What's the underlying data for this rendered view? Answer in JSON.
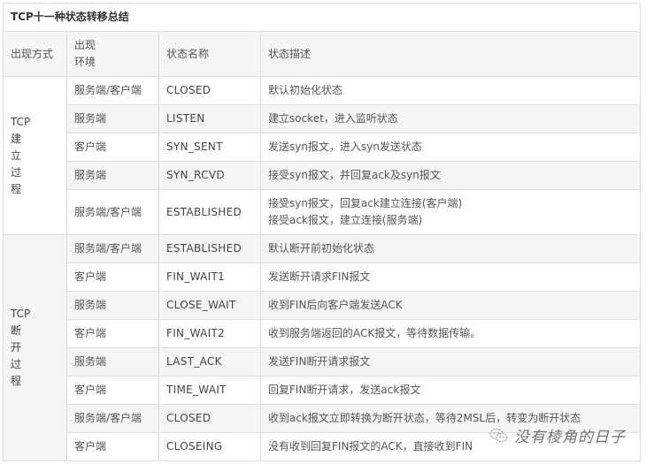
{
  "table": {
    "title": "TCP十一种状态转移总结",
    "headers": {
      "method": "出现方式",
      "environment_line1": "出现",
      "environment_line2": "环境",
      "state_name": "状态名称",
      "state_desc": "状态描述"
    },
    "phases": [
      {
        "label_lines": [
          "TCP",
          "建",
          "立",
          "过",
          "程"
        ],
        "rows": [
          {
            "env": "服务端/客户端",
            "state": "CLOSED",
            "desc": [
              "默认初始化状态"
            ]
          },
          {
            "env": "服务端",
            "state": "LISTEN",
            "desc": [
              "建立socket，进入监听状态"
            ]
          },
          {
            "env": "客户端",
            "state": "SYN_SENT",
            "desc": [
              "发送syn报文，进入syn发送状态"
            ]
          },
          {
            "env": "服务端",
            "state": "SYN_RCVD",
            "desc": [
              "接受syn报文，并回复ack及syn报文"
            ]
          },
          {
            "env": "服务端/客户端",
            "state": "ESTABLISHED",
            "desc": [
              "接受syn报文，回复ack建立连接(客户端)",
              "接受ack报文，建立连接(服务端)"
            ]
          }
        ]
      },
      {
        "label_lines": [
          "TCP",
          "断",
          "开",
          "过",
          "程"
        ],
        "rows": [
          {
            "env": "服务端/客户端",
            "state": "ESTABLISHED",
            "desc": [
              "默认断开前初始化状态"
            ]
          },
          {
            "env": "客户端",
            "state": "FIN_WAIT1",
            "desc": [
              "发送断开请求FIN报文"
            ]
          },
          {
            "env": "服务端",
            "state": "CLOSE_WAIT",
            "desc": [
              "收到FIN后向客户端发送ACK"
            ]
          },
          {
            "env": "客户端",
            "state": "FIN_WAIT2",
            "desc": [
              "收到服务端返回的ACK报文，等待数据传输。"
            ]
          },
          {
            "env": "服务端",
            "state": "LAST_ACK",
            "desc": [
              "发送FIN断开请求报文"
            ]
          },
          {
            "env": "客户端",
            "state": "TIME_WAIT",
            "desc": [
              "回复FIN断开请求，发送ack报文"
            ]
          },
          {
            "env": "服务端/客户端",
            "state": "CLOSED",
            "desc": [
              "收到ack报文立即转换为断开状态，等待2MSL后，转变为断开状态"
            ]
          },
          {
            "env": "客户端",
            "state": "CLOSEING",
            "desc": [
              "没有收到回复FIN报文的ACK，直接收到FIN"
            ]
          }
        ]
      }
    ]
  },
  "watermark": {
    "icon": "wechat-icon",
    "text": "没有棱角的日子"
  },
  "colors": {
    "border": "#dddddd",
    "stripe": "#f5f5f5",
    "text": "#333333"
  }
}
